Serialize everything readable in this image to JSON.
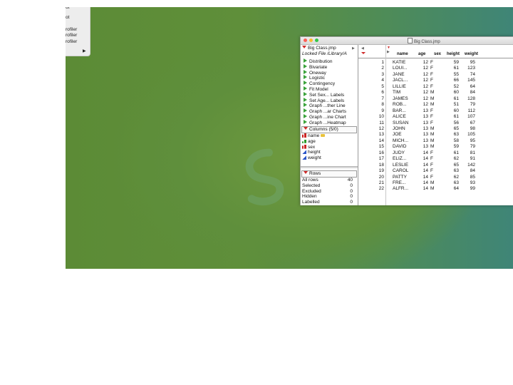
{
  "side_menu": {
    "items": [
      "ot",
      "ot",
      "rofiler",
      "rofiler",
      "rofiler"
    ],
    "submenu_arrow": "▶"
  },
  "window": {
    "title": "Big Class.jmp",
    "left_panel": {
      "table_name": "Big Class.jmp",
      "locked_file": "Locked File  /Library/A",
      "scripts": [
        "Distribution",
        "Bivariate",
        "Oneway",
        "Logistic",
        "Contingency",
        "Fit Model",
        "Set Sex... Labels",
        "Set Age... Labels",
        "Graph ...ther Line",
        "Graph ...ar Charts",
        "Graph ...ine Chart",
        "Graph ...Heatmap"
      ],
      "columns_header": "Columns (5/0)",
      "columns": [
        {
          "name": "name",
          "type": "nominal",
          "label": true
        },
        {
          "name": "age",
          "type": "ordinal",
          "label": false
        },
        {
          "name": "sex",
          "type": "nominal",
          "label": false
        },
        {
          "name": "height",
          "type": "continuous",
          "label": false
        },
        {
          "name": "weight",
          "type": "continuous",
          "label": false
        }
      ],
      "rows_header": "Rows",
      "row_stats": [
        {
          "label": "All rows",
          "value": "40"
        },
        {
          "label": "Selected",
          "value": "0"
        },
        {
          "label": "Excluded",
          "value": "0"
        },
        {
          "label": "Hidden",
          "value": "0"
        },
        {
          "label": "Labelled",
          "value": "0"
        }
      ]
    },
    "grid": {
      "headers": [
        "name",
        "age",
        "sex",
        "height",
        "weight"
      ],
      "rows": [
        [
          "1",
          "KATIE",
          "12",
          "F",
          "59",
          "95"
        ],
        [
          "2",
          "LOUI...",
          "12",
          "F",
          "61",
          "123"
        ],
        [
          "3",
          "JANE",
          "12",
          "F",
          "55",
          "74"
        ],
        [
          "4",
          "JACL...",
          "12",
          "F",
          "66",
          "145"
        ],
        [
          "5",
          "LILLIE",
          "12",
          "F",
          "52",
          "64"
        ],
        [
          "6",
          "TIM",
          "12",
          "M",
          "60",
          "84"
        ],
        [
          "7",
          "JAMES",
          "12",
          "M",
          "61",
          "128"
        ],
        [
          "8",
          "ROB...",
          "12",
          "M",
          "51",
          "79"
        ],
        [
          "9",
          "BAR...",
          "13",
          "F",
          "60",
          "112"
        ],
        [
          "10",
          "ALICE",
          "13",
          "F",
          "61",
          "107"
        ],
        [
          "11",
          "SUSAN",
          "13",
          "F",
          "56",
          "67"
        ],
        [
          "12",
          "JOHN",
          "13",
          "M",
          "65",
          "98"
        ],
        [
          "13",
          "JOE",
          "13",
          "M",
          "63",
          "105"
        ],
        [
          "14",
          "MICH...",
          "13",
          "M",
          "58",
          "95"
        ],
        [
          "15",
          "DAVID",
          "13",
          "M",
          "59",
          "79"
        ],
        [
          "16",
          "JUDY",
          "14",
          "F",
          "61",
          "81"
        ],
        [
          "17",
          "ELIZ...",
          "14",
          "F",
          "62",
          "91"
        ],
        [
          "18",
          "LESLIE",
          "14",
          "F",
          "65",
          "142"
        ],
        [
          "19",
          "CAROL",
          "14",
          "F",
          "63",
          "84"
        ],
        [
          "20",
          "PATTY",
          "14",
          "F",
          "62",
          "85"
        ],
        [
          "21",
          "FRE...",
          "14",
          "M",
          "63",
          "93"
        ],
        [
          "22",
          "ALFR...",
          "14",
          "M",
          "64",
          "99"
        ]
      ]
    }
  },
  "colors": {
    "desktop_green": "#5f8f3a",
    "desktop_teal": "#3f8577",
    "traffic_close": "#fc5f57",
    "traffic_min": "#fdbc2e",
    "traffic_max": "#33c748",
    "script_play": "#3aa23a",
    "disclosure": "#d02a2a"
  },
  "icons": {
    "desktop_logo": "sas-logo",
    "script": "play-icon",
    "disclosure": "disclosure-triangle-icon"
  }
}
